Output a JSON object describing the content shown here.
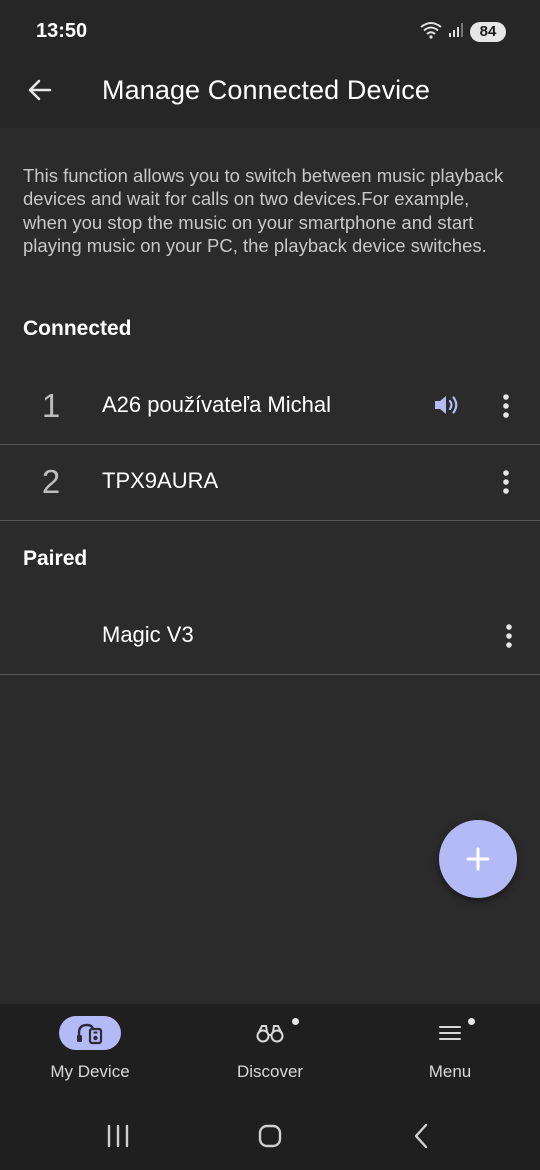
{
  "status_bar": {
    "time": "13:50",
    "battery": "84",
    "icons": [
      "wifi-icon",
      "signal-icon"
    ]
  },
  "header": {
    "title": "Manage Connected Device",
    "back_icon": "arrow-left-icon"
  },
  "description": "This function allows you to switch between music playback devices and wait for calls on two devices.For example, when you stop the music on your smartphone and start playing music on your PC, the playback device switches.",
  "connected": {
    "label": "Connected",
    "devices": [
      {
        "index": "1",
        "name": "A26 používateľa Michal",
        "playing": true
      },
      {
        "index": "2",
        "name": "TPX9AURA",
        "playing": false
      }
    ]
  },
  "paired": {
    "label": "Paired",
    "devices": [
      {
        "name": "Magic V3"
      }
    ]
  },
  "fab": {
    "icon": "plus-icon"
  },
  "bottom_nav": {
    "items": [
      {
        "label": "My Device",
        "icon": "headphones-device-icon",
        "active": true,
        "badge": false
      },
      {
        "label": "Discover",
        "icon": "binoculars-icon",
        "active": false,
        "badge": true
      },
      {
        "label": "Menu",
        "icon": "menu-icon",
        "active": false,
        "badge": true
      }
    ]
  },
  "system_nav": {
    "icons": [
      "recents-icon",
      "home-icon",
      "back-icon"
    ]
  },
  "colors": {
    "accent": "#b4baf6",
    "background": "#2b2b2b",
    "bar": "#1f1f1f"
  }
}
